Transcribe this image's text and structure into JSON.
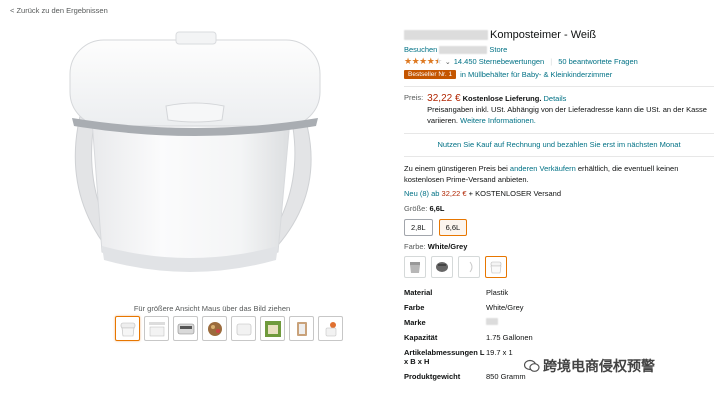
{
  "nav": {
    "back": "< Zurück zu den Ergebnissen"
  },
  "gallery": {
    "zoom_hint": "Für größere Ansicht Maus über das Bild ziehen",
    "thumbnail_count": 8
  },
  "product": {
    "title_suffix": "Komposteimer - Weiß",
    "visit_prefix": "Besuchen",
    "visit_suffix": "Store",
    "rating": 4.5,
    "rating_value": "4,5",
    "ratings_text": "14.450 Sternebewertungen",
    "questions_text": "50 beantwortete Fragen",
    "badge": "Bestseller Nr. 1",
    "category_text": "in Müllbehälter für Baby- & Kleinkinderzimmer"
  },
  "price": {
    "label": "Preis:",
    "amount": "32,22 €",
    "shipping": "Kostenlose Lieferung.",
    "details": "Details",
    "vat_note": "Preisangaben inkl. USt. Abhängig von der Lieferadresse kann die USt. an der Kasse variieren.",
    "more_info": "Weitere Informationen."
  },
  "offers": {
    "invoice_link": "Nutzen Sie Kauf auf Rechnung und bezahlen Sie erst im nächsten Monat",
    "cheaper_prefix": "Zu einem günstigeren Preis bei",
    "cheaper_link": "anderen Verkäufern",
    "cheaper_suffix": "erhältlich, die eventuell keinen kostenlosen Prime-Versand anbieten.",
    "new_link": "Neu (8) ab",
    "new_price": "32,22 €",
    "new_suffix": "+ KOSTENLOSER Versand"
  },
  "size": {
    "label": "Größe:",
    "value": "6,6L",
    "options": [
      "2,8L",
      "6,6L"
    ],
    "selected": 1
  },
  "color": {
    "label": "Farbe:",
    "value": "White/Grey",
    "swatch_count": 4,
    "selected": 3
  },
  "specs": [
    {
      "key": "Material",
      "value": "Plastik"
    },
    {
      "key": "Farbe",
      "value": "White/Grey"
    },
    {
      "key": "Marke",
      "value": ""
    },
    {
      "key": "Kapazität",
      "value": "1.75 Gallonen"
    },
    {
      "key": "Artikelabmessungen L x B x H",
      "value": "19.7 x 1"
    },
    {
      "key": "Produktgewicht",
      "value": "850 Gramm"
    }
  ],
  "watermark": {
    "text": "跨境电商侵权预警"
  },
  "colors": {
    "link": "#007185",
    "price": "#b12704",
    "star": "#de7921",
    "selected_border": "#e77600",
    "badge": "#c45500"
  }
}
